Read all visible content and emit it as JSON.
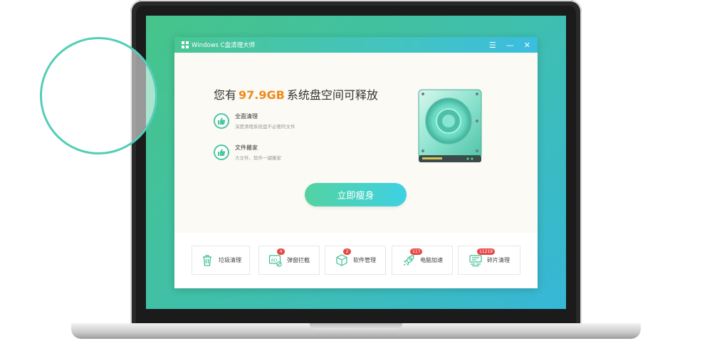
{
  "app": {
    "title": "Windows C盘清理大师",
    "controls": {
      "menu": "☰",
      "minimize": "—",
      "close": "✕"
    }
  },
  "headline": {
    "prefix": "您有",
    "amount": "97.9GB",
    "suffix": "系统盘空间可释放"
  },
  "features": [
    {
      "title": "全面清理",
      "desc": "深度清理系统盘不必要的文件",
      "icon": "thumbs-up-icon"
    },
    {
      "title": "文件搬家",
      "desc": "大文件、软件一键搬家",
      "icon": "thumbs-up-icon"
    }
  ],
  "primary_button": "立即瘦身",
  "tools": [
    {
      "label": "垃圾清理",
      "badge": "",
      "icon": "trash-icon"
    },
    {
      "label": "弹窗拦截",
      "badge": "4",
      "icon": "ad-block-icon"
    },
    {
      "label": "软件管理",
      "badge": "2",
      "icon": "box-icon"
    },
    {
      "label": "电脑加速",
      "badge": "117",
      "icon": "rocket-icon"
    },
    {
      "label": "碎片清理",
      "badge": "11219",
      "icon": "fragment-icon"
    }
  ],
  "colors": {
    "accent": "#46c48a",
    "amount": "#f08a1c",
    "badge": "#e74747",
    "secondary": "#3bbde0"
  }
}
